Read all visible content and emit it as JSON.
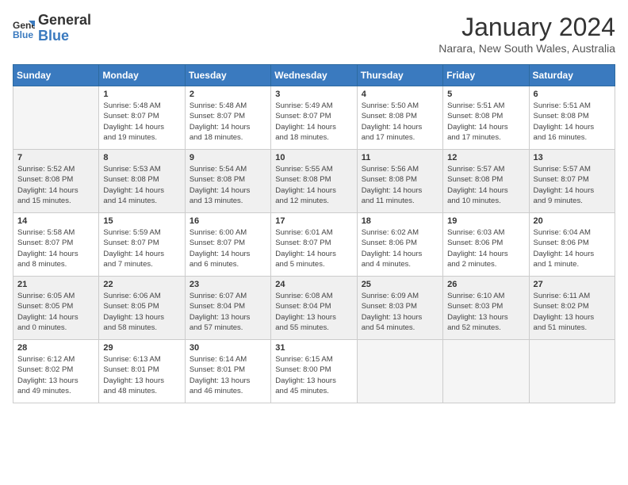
{
  "logo": {
    "line1": "General",
    "line2": "Blue"
  },
  "title": "January 2024",
  "subtitle": "Narara, New South Wales, Australia",
  "days_header": [
    "Sunday",
    "Monday",
    "Tuesday",
    "Wednesday",
    "Thursday",
    "Friday",
    "Saturday"
  ],
  "weeks": [
    [
      {
        "day": "",
        "info": ""
      },
      {
        "day": "1",
        "info": "Sunrise: 5:48 AM\nSunset: 8:07 PM\nDaylight: 14 hours\nand 19 minutes."
      },
      {
        "day": "2",
        "info": "Sunrise: 5:48 AM\nSunset: 8:07 PM\nDaylight: 14 hours\nand 18 minutes."
      },
      {
        "day": "3",
        "info": "Sunrise: 5:49 AM\nSunset: 8:07 PM\nDaylight: 14 hours\nand 18 minutes."
      },
      {
        "day": "4",
        "info": "Sunrise: 5:50 AM\nSunset: 8:08 PM\nDaylight: 14 hours\nand 17 minutes."
      },
      {
        "day": "5",
        "info": "Sunrise: 5:51 AM\nSunset: 8:08 PM\nDaylight: 14 hours\nand 17 minutes."
      },
      {
        "day": "6",
        "info": "Sunrise: 5:51 AM\nSunset: 8:08 PM\nDaylight: 14 hours\nand 16 minutes."
      }
    ],
    [
      {
        "day": "7",
        "info": "Sunrise: 5:52 AM\nSunset: 8:08 PM\nDaylight: 14 hours\nand 15 minutes."
      },
      {
        "day": "8",
        "info": "Sunrise: 5:53 AM\nSunset: 8:08 PM\nDaylight: 14 hours\nand 14 minutes."
      },
      {
        "day": "9",
        "info": "Sunrise: 5:54 AM\nSunset: 8:08 PM\nDaylight: 14 hours\nand 13 minutes."
      },
      {
        "day": "10",
        "info": "Sunrise: 5:55 AM\nSunset: 8:08 PM\nDaylight: 14 hours\nand 12 minutes."
      },
      {
        "day": "11",
        "info": "Sunrise: 5:56 AM\nSunset: 8:08 PM\nDaylight: 14 hours\nand 11 minutes."
      },
      {
        "day": "12",
        "info": "Sunrise: 5:57 AM\nSunset: 8:08 PM\nDaylight: 14 hours\nand 10 minutes."
      },
      {
        "day": "13",
        "info": "Sunrise: 5:57 AM\nSunset: 8:07 PM\nDaylight: 14 hours\nand 9 minutes."
      }
    ],
    [
      {
        "day": "14",
        "info": "Sunrise: 5:58 AM\nSunset: 8:07 PM\nDaylight: 14 hours\nand 8 minutes."
      },
      {
        "day": "15",
        "info": "Sunrise: 5:59 AM\nSunset: 8:07 PM\nDaylight: 14 hours\nand 7 minutes."
      },
      {
        "day": "16",
        "info": "Sunrise: 6:00 AM\nSunset: 8:07 PM\nDaylight: 14 hours\nand 6 minutes."
      },
      {
        "day": "17",
        "info": "Sunrise: 6:01 AM\nSunset: 8:07 PM\nDaylight: 14 hours\nand 5 minutes."
      },
      {
        "day": "18",
        "info": "Sunrise: 6:02 AM\nSunset: 8:06 PM\nDaylight: 14 hours\nand 4 minutes."
      },
      {
        "day": "19",
        "info": "Sunrise: 6:03 AM\nSunset: 8:06 PM\nDaylight: 14 hours\nand 2 minutes."
      },
      {
        "day": "20",
        "info": "Sunrise: 6:04 AM\nSunset: 8:06 PM\nDaylight: 14 hours\nand 1 minute."
      }
    ],
    [
      {
        "day": "21",
        "info": "Sunrise: 6:05 AM\nSunset: 8:05 PM\nDaylight: 14 hours\nand 0 minutes."
      },
      {
        "day": "22",
        "info": "Sunrise: 6:06 AM\nSunset: 8:05 PM\nDaylight: 13 hours\nand 58 minutes."
      },
      {
        "day": "23",
        "info": "Sunrise: 6:07 AM\nSunset: 8:04 PM\nDaylight: 13 hours\nand 57 minutes."
      },
      {
        "day": "24",
        "info": "Sunrise: 6:08 AM\nSunset: 8:04 PM\nDaylight: 13 hours\nand 55 minutes."
      },
      {
        "day": "25",
        "info": "Sunrise: 6:09 AM\nSunset: 8:03 PM\nDaylight: 13 hours\nand 54 minutes."
      },
      {
        "day": "26",
        "info": "Sunrise: 6:10 AM\nSunset: 8:03 PM\nDaylight: 13 hours\nand 52 minutes."
      },
      {
        "day": "27",
        "info": "Sunrise: 6:11 AM\nSunset: 8:02 PM\nDaylight: 13 hours\nand 51 minutes."
      }
    ],
    [
      {
        "day": "28",
        "info": "Sunrise: 6:12 AM\nSunset: 8:02 PM\nDaylight: 13 hours\nand 49 minutes."
      },
      {
        "day": "29",
        "info": "Sunrise: 6:13 AM\nSunset: 8:01 PM\nDaylight: 13 hours\nand 48 minutes."
      },
      {
        "day": "30",
        "info": "Sunrise: 6:14 AM\nSunset: 8:01 PM\nDaylight: 13 hours\nand 46 minutes."
      },
      {
        "day": "31",
        "info": "Sunrise: 6:15 AM\nSunset: 8:00 PM\nDaylight: 13 hours\nand 45 minutes."
      },
      {
        "day": "",
        "info": ""
      },
      {
        "day": "",
        "info": ""
      },
      {
        "day": "",
        "info": ""
      }
    ]
  ]
}
